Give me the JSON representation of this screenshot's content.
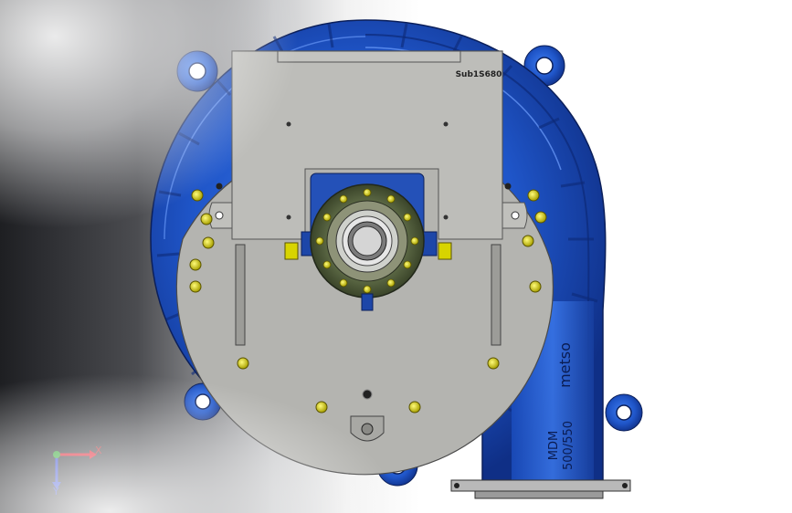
{
  "model": {
    "part_number": "Sub1S680",
    "brand_mark": "metso",
    "model_label_line1": "MDM",
    "model_label_line2": "500/550"
  },
  "triad": {
    "x_label": "X",
    "y_label": "Y"
  },
  "colors": {
    "casing_blue": "#1f55c8",
    "plate_gray": "#b4b4b0",
    "flange_green": "#4d5a3a",
    "bolt_yellow": "#d8d400"
  }
}
